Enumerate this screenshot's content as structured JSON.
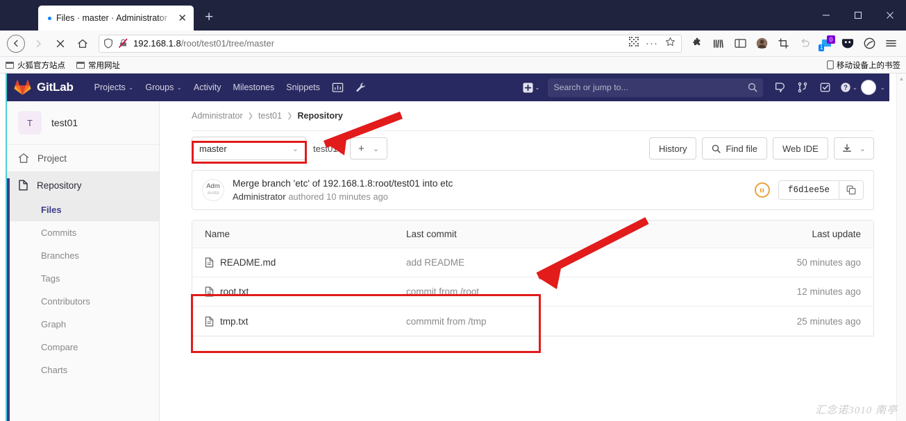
{
  "browser": {
    "tab": {
      "title": "Files · master · Administrator",
      "close_label": "✕"
    },
    "new_tab_label": "+",
    "url": {
      "host": "192.168.1.8",
      "path": "/root/test01/tree/master"
    },
    "window_controls": {
      "minimize": "minimize",
      "maximize": "maximize",
      "close": "close"
    },
    "bookmarks": [
      {
        "label": "火狐官方站点"
      },
      {
        "label": "常用网址"
      }
    ],
    "bookmarks_right": {
      "label": "移动设备上的书签"
    },
    "notification_badges": {
      "blue": "1",
      "purple": "0"
    }
  },
  "gitlab": {
    "brand": "GitLab",
    "nav": [
      {
        "label": "Projects",
        "has_caret": true
      },
      {
        "label": "Groups",
        "has_caret": true
      },
      {
        "label": "Activity",
        "has_caret": false
      },
      {
        "label": "Milestones",
        "has_caret": false
      },
      {
        "label": "Snippets",
        "has_caret": false
      }
    ],
    "search_placeholder": "Search or jump to...",
    "icons": {
      "analytics": "chart-icon",
      "wrench": "wrench-icon",
      "plus": "plus-icon",
      "issues": "issues-icon",
      "merge_requests": "merge-request-icon",
      "todos": "todos-icon",
      "help": "help-icon",
      "avatar": "user-avatar"
    }
  },
  "sidebar": {
    "project": {
      "initial": "T",
      "name": "test01"
    },
    "items": [
      {
        "label": "Project",
        "icon": "home-icon",
        "type": "top"
      },
      {
        "label": "Repository",
        "icon": "document-icon",
        "type": "section"
      },
      {
        "label": "Files",
        "type": "sub",
        "active": true
      },
      {
        "label": "Commits",
        "type": "sub",
        "active": false
      },
      {
        "label": "Branches",
        "type": "sub",
        "active": false
      },
      {
        "label": "Tags",
        "type": "sub",
        "active": false
      },
      {
        "label": "Contributors",
        "type": "sub",
        "active": false
      },
      {
        "label": "Graph",
        "type": "sub",
        "active": false
      },
      {
        "label": "Compare",
        "type": "sub",
        "active": false
      },
      {
        "label": "Charts",
        "type": "sub",
        "active": false
      }
    ]
  },
  "main": {
    "breadcrumb": [
      {
        "label": "Administrator"
      },
      {
        "label": "test01"
      },
      {
        "label": "Repository",
        "current": true
      }
    ],
    "branch_selector": {
      "value": "master",
      "caret": "⌄"
    },
    "path": {
      "repo": "test01",
      "separator": "/"
    },
    "add_button": {
      "plus": "+",
      "caret": "⌄"
    },
    "actions": [
      {
        "label": "History",
        "icon": null
      },
      {
        "label": "Find file",
        "icon": "search-icon"
      },
      {
        "label": "Web IDE",
        "icon": null
      }
    ],
    "download_button": {
      "icon": "download-icon",
      "caret": "⌄"
    },
    "commit": {
      "avatar_line1": "Adm",
      "avatar_line2": "avata",
      "title": "Merge branch 'etc' of 192.168.1.8:root/test01 into etc",
      "author": "Administrator",
      "meta": "authored 10 minutes ago",
      "status_icon": "pipeline-pending-icon",
      "hash": "f6d1ee5e",
      "copy_icon": "copy-icon"
    },
    "table": {
      "headers": {
        "name": "Name",
        "last_commit": "Last commit",
        "last_update": "Last update"
      },
      "rows": [
        {
          "name": "README.md",
          "icon": "file-icon",
          "last_commit": "add README",
          "last_update": "50 minutes ago",
          "highlighted": false
        },
        {
          "name": "root.txt",
          "icon": "file-icon",
          "last_commit": "commit from /root",
          "last_update": "12 minutes ago",
          "highlighted": true
        },
        {
          "name": "tmp.txt",
          "icon": "file-icon",
          "last_commit": "commmit from /tmp",
          "last_update": "25 minutes ago",
          "highlighted": true
        }
      ]
    }
  },
  "annotations": {
    "arrow_color": "#e21b1b",
    "box_color": "#e21b1b",
    "watermark": "汇念诺3010 南亭"
  },
  "colors": {
    "gitlab_header": "#292961",
    "gitlab_search": "#39396d",
    "accent_teal": "#4dd0d8",
    "sidebar_accent": "#3c3c8c",
    "link": "#3c3c8c",
    "pipeline_pending": "#e8a33d"
  }
}
